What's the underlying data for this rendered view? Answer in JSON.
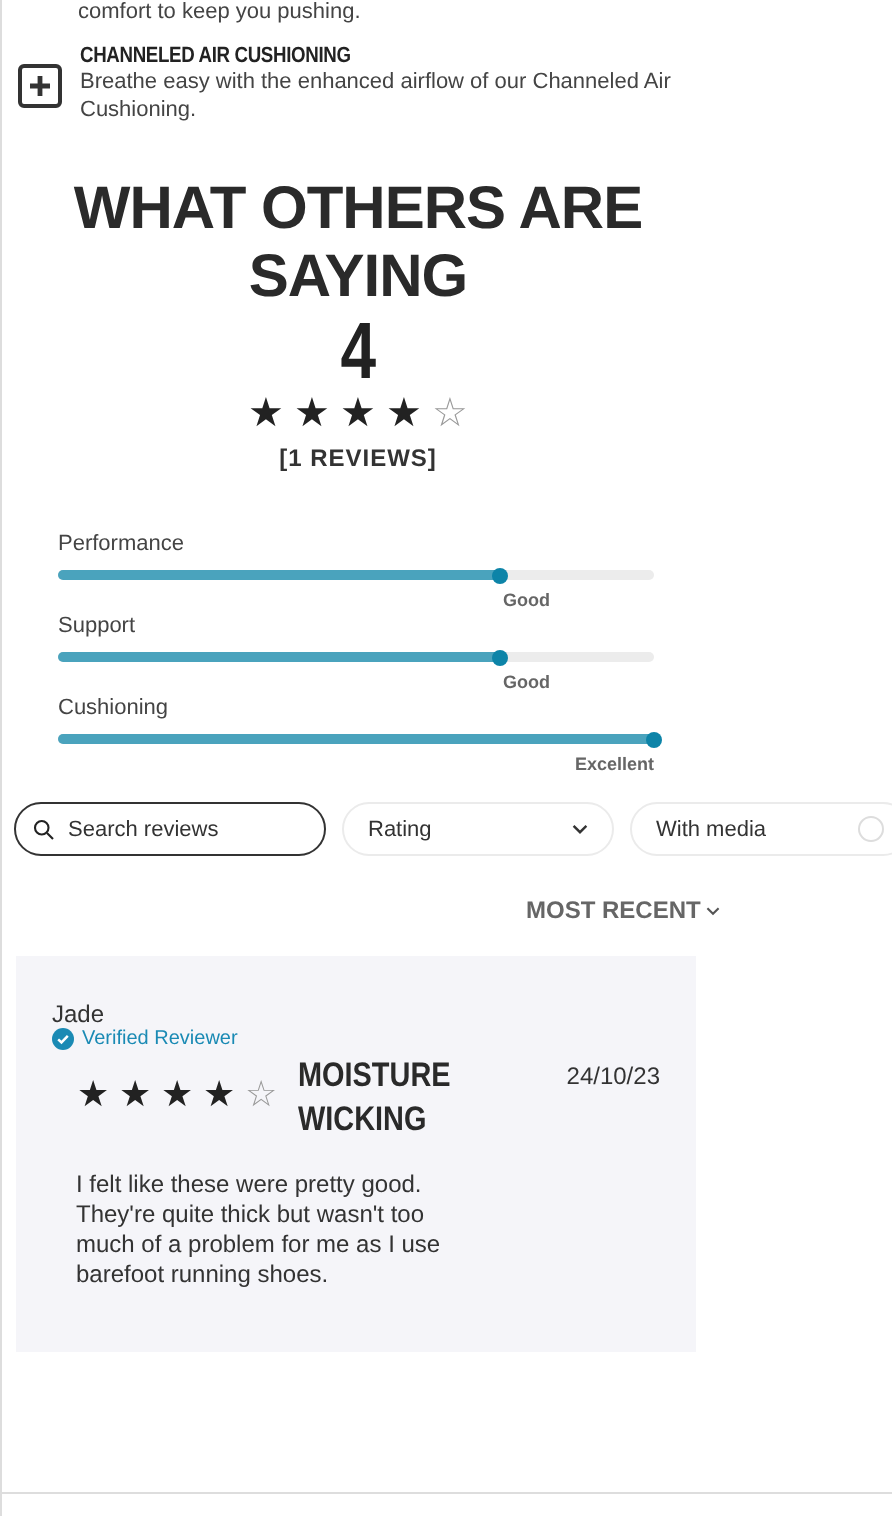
{
  "intro_tail": "comfort to keep you pushing.",
  "feature": {
    "title": "CHANNELED AIR CUSHIONING",
    "description": "Breathe easy with the enhanced airflow of our Channeled Air Cushioning."
  },
  "summary": {
    "heading": "WHAT OTHERS ARE SAYING",
    "score": "4",
    "stars": 4,
    "count": "[1 REVIEWS]"
  },
  "ratings": [
    {
      "name": "Performance",
      "level": 0.74,
      "reading": "Good"
    },
    {
      "name": "Support",
      "level": 0.74,
      "reading": "Good"
    },
    {
      "name": "Cushioning",
      "level": 1,
      "reading": "Excellent"
    }
  ],
  "filters": {
    "search_placeholder": "Search reviews",
    "rating": "Rating",
    "with_media": "With media",
    "with_media_checked": false
  },
  "sort": "MOST RECENT",
  "reviews": [
    {
      "author": "Jade",
      "verified": true,
      "verified_label": "Verified Reviewer",
      "stars": 4,
      "title": "MOISTURE WICKING",
      "date": "24/10/23",
      "body": "I felt like these were pretty good. They're quite thick but wasn't too much of a problem for me as I use barefoot running shoes."
    }
  ]
}
